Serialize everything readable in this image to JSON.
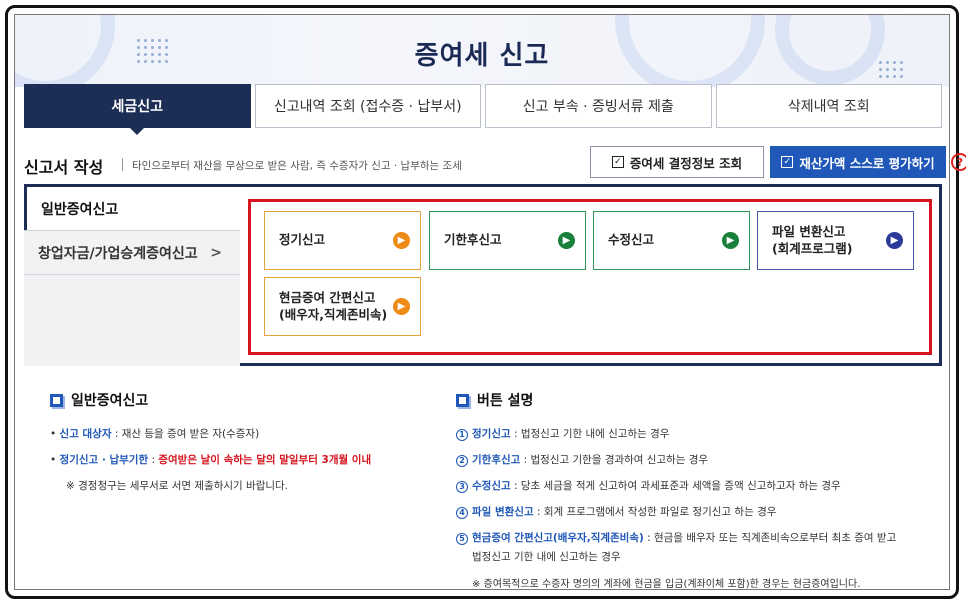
{
  "banner": {
    "title": "증여세 신고"
  },
  "tabs": [
    {
      "label": "세금신고",
      "active": true
    },
    {
      "label": "신고내역 조회 (접수증 · 납부서)"
    },
    {
      "label": "신고 부속 · 증빙서류 제출"
    },
    {
      "label": "삭제내역 조회"
    }
  ],
  "section": {
    "title": "신고서 작성",
    "description": "타인으로부터 재산을 무상으로 받은 사람, 즉 수증자가 신고 · 납부하는 조세",
    "lookup_button": "증여세 결정정보 조회",
    "evaluate_button": "재산가액 스스로 평가하기",
    "help": "?"
  },
  "side_menu": [
    {
      "label": "일반증여신고",
      "active": true
    },
    {
      "label": "창업자금/가업승계증여신고",
      "chevron": ">"
    }
  ],
  "cards": [
    {
      "label": "정기신고",
      "color": "orange"
    },
    {
      "label": "기한후신고",
      "color": "green"
    },
    {
      "label": "수정신고",
      "color": "green"
    },
    {
      "label_line1": "파일 변환신고",
      "label_line2": "(회계프로그램)",
      "color": "navy"
    },
    {
      "label_line1": "현금증여 간편신고",
      "label_line2": "(배우자,직계존비속)",
      "color": "orange"
    }
  ],
  "info_left": {
    "title": "일반증여신고",
    "target_label": "신고 대상자",
    "target_text": " : 재산 등을 증여 받은 자(수증자)",
    "deadline_label": "정기신고 · 납부기한",
    "deadline_sep": " : ",
    "deadline_text": "증여받은 날이 속하는 달의 말일부터 3개월 이내",
    "note": "※ 경정청구는 세무서로 서면 제출하시기 바랍니다."
  },
  "info_right": {
    "title": "버튼 설명",
    "items": [
      {
        "num": "1",
        "label": "정기신고",
        "text": " : 법정신고 기한 내에 신고하는 경우"
      },
      {
        "num": "2",
        "label": "기한후신고",
        "text": " : 법정신고 기한을 경과하여 신고하는 경우"
      },
      {
        "num": "3",
        "label": "수정신고",
        "text": " : 당초 세금을 적게 신고하여 과세표준과 세액을 증액 신고하고자 하는 경우"
      },
      {
        "num": "4",
        "label": "파일 변환신고",
        "text": " : 회계 프로그램에서 작성한 파일로 정기신고 하는 경우"
      },
      {
        "num": "5",
        "label": "현금증여 간편신고(배우자,직계존비속)",
        "text": " : 현금을 배우자 또는 직계존비속으로부터 최초 증여 받고"
      }
    ],
    "item5_cont": "법정신고 기한 내에 신고하는 경우",
    "note": "※ 증여목적으로 수증자 명의의 계좌에 현금을 입금(계좌이체 포함)한 경우는 현금증여입니다."
  }
}
